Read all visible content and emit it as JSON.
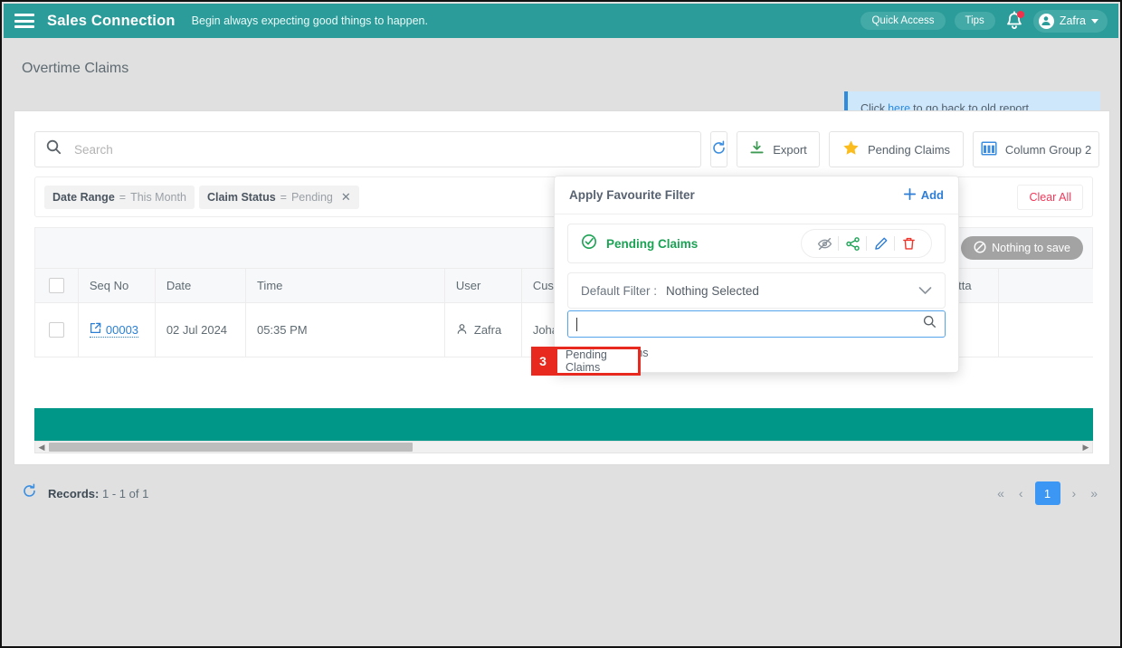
{
  "topbar": {
    "menu_icon": "hamburger-icon",
    "brand": "Sales Connection",
    "tagline": "Begin always expecting good things to happen.",
    "quick_access": "Quick Access",
    "tips": "Tips",
    "notification_icon": "bell-icon",
    "user_name": "Zafra",
    "brand_color": "#2b9c99"
  },
  "header": {
    "page_title": "Overtime Claims",
    "notice_prefix": "Click",
    "notice_link": "here",
    "notice_suffix": "to go back to old report"
  },
  "toolbar": {
    "search_placeholder": "Search",
    "search_value": "",
    "search_icon": "search-icon",
    "refresh_label": "",
    "refresh_icon": "refresh-icon",
    "export_label": "Export",
    "export_icon": "download-icon",
    "favourite_label": "Pending Claims",
    "favourite_icon": "star-icon",
    "column_group_label": "Column Group 2",
    "column_group_icon": "columns-icon"
  },
  "filters": {
    "chips": [
      {
        "name": "Date Range",
        "operator": "=",
        "value": "This Month",
        "removable": false
      },
      {
        "name": "Claim Status",
        "operator": "=",
        "value": "Pending",
        "removable": true
      }
    ],
    "clear_all": "Clear All"
  },
  "grid_tools": {
    "nothing_to_save": "Nothing to save",
    "nothing_to_save_icon": "no-entry-icon"
  },
  "table": {
    "columns": [
      "",
      "Seq No",
      "Date",
      "Time",
      "User",
      "Customer",
      "",
      "Atta",
      ""
    ],
    "rows": [
      {
        "checked": false,
        "seq_no": "00003",
        "date": "02 Jul 2024",
        "time": "05:35 PM",
        "user": "Zafra",
        "customer": "Johan",
        "blank": "",
        "attachment": "-",
        "tail": ""
      }
    ],
    "summary_bar_color": "#009688"
  },
  "footer": {
    "refresh_icon": "refresh-icon",
    "records_label": "Records:",
    "records_range": "1 - 1",
    "records_of": "of",
    "records_total": "1",
    "pager": {
      "first": "«",
      "prev": "‹",
      "current": "1",
      "next": "›",
      "last": "»"
    }
  },
  "popup": {
    "title": "Apply Favourite Filter",
    "add_label": "Add",
    "add_icon": "plus-icon",
    "favourite": {
      "name": "Pending Claims",
      "status_icon": "check-circle-icon",
      "actions": [
        {
          "icon": "eye-off-icon",
          "color": "#8a929b"
        },
        {
          "icon": "share-icon",
          "color": "#1ba254"
        },
        {
          "icon": "pencil-icon",
          "color": "#2e7ed6"
        },
        {
          "icon": "trash-icon",
          "color": "#f0352b"
        }
      ]
    },
    "default_filter_label": "Default Filter :",
    "default_filter_value": "Nothing Selected",
    "default_filter_chevron": "chevron-down-icon",
    "dropdown_search_value": "",
    "dropdown_search_icon": "search-icon",
    "dropdown_options": [
      "Pending Claims"
    ]
  },
  "annotation": {
    "step_number": "3",
    "label": "Pending Claims",
    "color": "#e8291f"
  }
}
